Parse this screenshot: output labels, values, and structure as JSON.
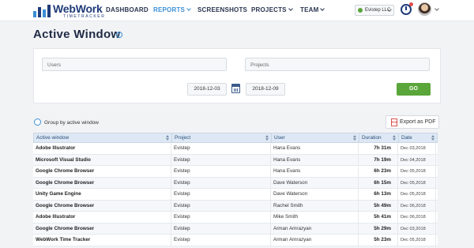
{
  "header": {
    "logo_word": "WebWork",
    "logo_sub": "TIMETRACKER",
    "nav": [
      {
        "label": "DASHBOARD"
      },
      {
        "label": "REPORTS"
      },
      {
        "label": "SCREENSHOTS"
      },
      {
        "label": "PROJECTS"
      },
      {
        "label": "TEAM"
      }
    ],
    "company": "Evistep LLC"
  },
  "page": {
    "title": "Active Window",
    "info": "i"
  },
  "filters": {
    "users_placeholder": "Users",
    "projects_placeholder": "Projects",
    "date_from": "2018-12-03",
    "date_to": "2018-12-09",
    "go_label": "GO"
  },
  "controls": {
    "group_label": "Group by active window",
    "pdf_label": "Export as PDF",
    "pdf_icon_text": "PDF"
  },
  "table": {
    "columns": [
      "Active window",
      "Project",
      "User",
      "Duration",
      "Date"
    ],
    "rows": [
      {
        "app": "Adobe Illustrator",
        "project": "Evistep",
        "user": "Hana Evans",
        "duration": "7h 31m",
        "date": "Dec 03,2018"
      },
      {
        "app": "Microsoft Visual Studio",
        "project": "Evistep",
        "user": "Hana Evans",
        "duration": "7h 19m",
        "date": "Dec 04,2018"
      },
      {
        "app": "Google Chrome Browser",
        "project": "Evistep",
        "user": "Hana Evans",
        "duration": "6h 23m",
        "date": "Dec 05,2018"
      },
      {
        "app": "Google Chrome Browser",
        "project": "Evistep",
        "user": "Dave Waterson",
        "duration": "6h 15m",
        "date": "Dec 05,2018"
      },
      {
        "app": "Unity Game Engine",
        "project": "Evistep",
        "user": "Dave Waterson",
        "duration": "6h 13m",
        "date": "Dec 05,2018"
      },
      {
        "app": "Google Chrome Browser",
        "project": "Evistep",
        "user": "Rachel Smith",
        "duration": "5h 49m",
        "date": "Dec 06,2018"
      },
      {
        "app": "Adobe Illustrator",
        "project": "Evistep",
        "user": "Mike Smith",
        "duration": "5h 41m",
        "date": "Dec 06,2018"
      },
      {
        "app": "Google Chrome Browser",
        "project": "Evistep",
        "user": "Arman Amrazyan",
        "duration": "5h 29m",
        "date": "Dec 03,2018"
      },
      {
        "app": "WebWork Time Tracker",
        "project": "Evistep",
        "user": "Arman Amrazyan",
        "duration": "5h 23m",
        "date": "Dec 05,2018"
      }
    ]
  },
  "colors": {
    "accent": "#3a8fd6",
    "brand": "#1f3b78",
    "go": "#5aa63a"
  }
}
